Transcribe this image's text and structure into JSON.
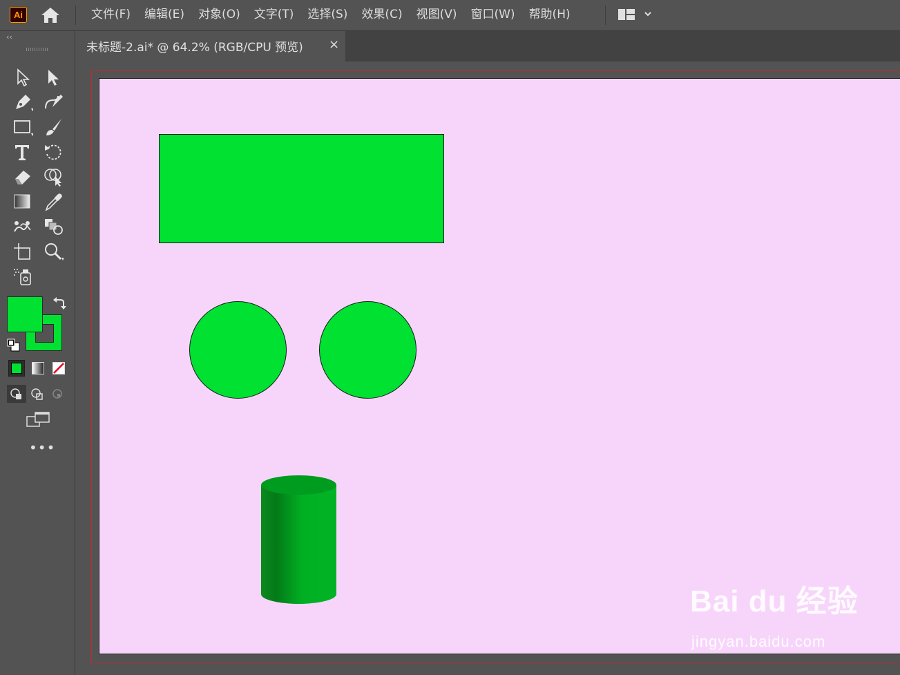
{
  "app": {
    "logo_text": "Ai"
  },
  "menu": {
    "items": [
      "文件(F)",
      "编辑(E)",
      "对象(O)",
      "文字(T)",
      "选择(S)",
      "效果(C)",
      "视图(V)",
      "窗口(W)",
      "帮助(H)"
    ]
  },
  "document_tab": {
    "title": "未标题-2.ai* @ 64.2% (RGB/CPU 预览)",
    "close_glyph": "×"
  },
  "toolbar": {
    "collapse_glyph": "‹‹",
    "more_glyph": "•••",
    "tools": [
      "selection-tool",
      "direct-selection-tool",
      "pen-tool",
      "curvature-tool",
      "rectangle-tool",
      "paintbrush-tool",
      "type-tool",
      "rotate-tool",
      "eraser-tool",
      "shape-builder-tool",
      "gradient-tool",
      "eyedropper-tool",
      "puppet-warp-tool",
      "blend-tool",
      "artboard-tool",
      "zoom-tool",
      "symbol-sprayer-tool"
    ],
    "fill_color": "#00e132",
    "stroke_color": "#00e132"
  },
  "colors": {
    "artboard_bg": "#f7d5fb",
    "shape_fill": "#00e132",
    "bleed_line": "#c8262b"
  },
  "watermark": {
    "logo": "Bai  du 经验",
    "url": "jingyan.baidu.com"
  }
}
